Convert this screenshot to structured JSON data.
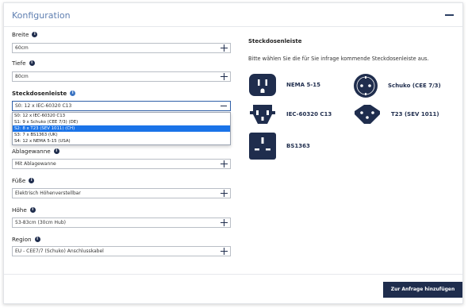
{
  "panel": {
    "title": "Konfiguration"
  },
  "fields": {
    "breite": {
      "label": "Breite",
      "value": "60cm"
    },
    "tiefe": {
      "label": "Tiefe",
      "value": "80cm"
    },
    "steckdosenleiste": {
      "label": "Steckdosenleiste",
      "value": "S0: 12 x IEC-60320 C13"
    },
    "ablagewanne": {
      "label": "Ablagewanne",
      "value": "Mit Ablagewanne"
    },
    "fuesse": {
      "label": "Füße",
      "value": "Elektrisch Höhenverstellbar"
    },
    "hoehe": {
      "label": "Höhe",
      "value": "53-83cm (30cm Hub)"
    },
    "region": {
      "label": "Region",
      "value": "EU - CEE7/7 (Schuko) Anschlusskabel"
    }
  },
  "dropdown": {
    "options": [
      "S0: 12 x IEC-60320 C13",
      "S1: 9 x Schuko (CEE 7/3) (DE)",
      "S2: 8 x T23 (SEV 1011) (CH)",
      "S3: 7 x BS1363 (UK)",
      "S4: 12 x NEMA 5-15 (USA)"
    ],
    "highlighted_index": 2
  },
  "info_panel": {
    "title": "Steckdosenleiste",
    "text": "Bitte wählen Sie die für Sie infrage kommende Steckdosenleiste aus."
  },
  "sockets": [
    {
      "label": "NEMA 5-15",
      "icon": "nema-socket-icon"
    },
    {
      "label": "Schuko (CEE 7/3)",
      "icon": "schuko-socket-icon"
    },
    {
      "label": "IEC-60320 C13",
      "icon": "iec-socket-icon"
    },
    {
      "label": "T23 (SEV 1011)",
      "icon": "t23-socket-icon"
    },
    {
      "label": "BS1363",
      "icon": "bs1363-socket-icon"
    }
  ],
  "actions": {
    "submit_label": "Zur Anfrage hinzufügen"
  },
  "colors": {
    "accent_navy": "#1f2d4d",
    "title_blue": "#5f7fb1",
    "selection_blue": "#1a73e8"
  }
}
